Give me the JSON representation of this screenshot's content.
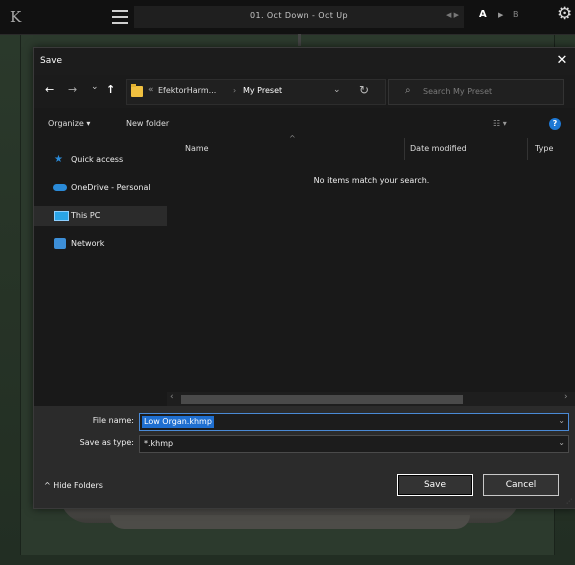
{
  "plugin": {
    "logo": "K",
    "preset_name": "01. Oct Down - Oct Up",
    "nav_arrows": "◀ ▶",
    "ab_a": "A",
    "ab_arrow": "▶",
    "ab_b": "B",
    "menu_icon": "hamburger-icon",
    "settings_icon": "gear-icon"
  },
  "dialog": {
    "title": "Save",
    "close_label": "✕",
    "nav": {
      "back": "←",
      "forward": "→",
      "recent": "⌄",
      "up": "↑"
    },
    "address": {
      "overflow": "«",
      "crumbs": [
        "EfektorHarm...",
        "My Preset"
      ],
      "separator": "›",
      "dropdown": "⌄",
      "refresh": "↻"
    },
    "search": {
      "placeholder": "Search My Preset"
    },
    "toolbar": {
      "organize": "Organize ▾",
      "new_folder": "New folder",
      "view": "☷ ▾",
      "help": "?"
    },
    "sidebar": {
      "items": [
        {
          "label": "Quick access",
          "icon": "star-icon",
          "icon_color": "#2a8ad8"
        },
        {
          "label": "OneDrive - Personal",
          "icon": "cloud-icon",
          "icon_color": "#2a8ad8"
        },
        {
          "label": "This PC",
          "icon": "computer-icon",
          "selected": true
        },
        {
          "label": "Network",
          "icon": "network-icon"
        }
      ]
    },
    "columns": [
      "Name",
      "Date modified",
      "Type"
    ],
    "sort_indicator": "^",
    "empty_message": "No items match your search.",
    "file_name_label": "File name:",
    "file_name_value": "Low Organ.khmp",
    "save_as_type_label": "Save as type:",
    "save_as_type_value": "*.khmp",
    "hide_folders": "^ Hide Folders",
    "save_button": "Save",
    "cancel_button": "Cancel"
  }
}
